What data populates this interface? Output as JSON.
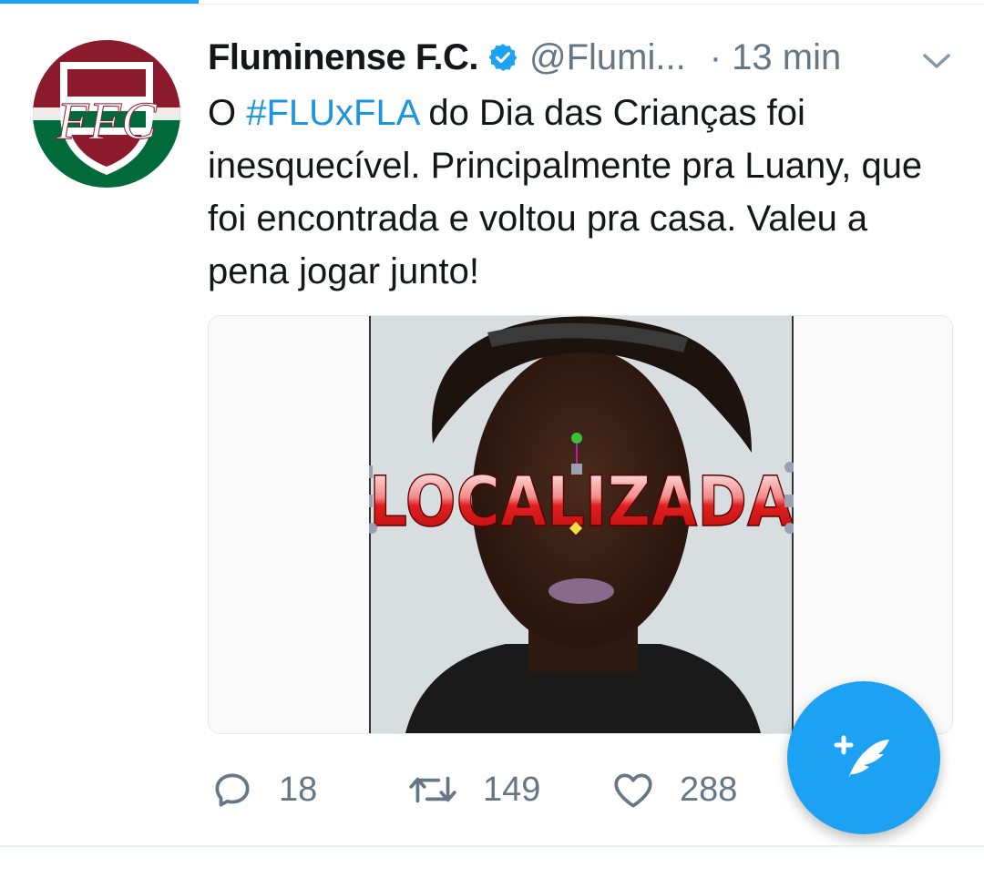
{
  "tweet": {
    "display_name": "Fluminense F.C.",
    "handle": "@Flumi...",
    "separator": "·",
    "time": "13 min",
    "text_prefix": "O ",
    "hashtag": "#FLUxFLA",
    "text_suffix": " do Dia das Crianças foi inesquecível. Principalmente pra Luany, que foi encontrada e voltou pra casa. Valeu a pena jogar junto!",
    "image_overlay_text": "LOCALIZADA",
    "avatar_monogram": "FFC",
    "club_colors": {
      "maroon": "#8b1a2c",
      "green": "#006a3a",
      "white": "#ffffff"
    }
  },
  "actions": {
    "replies": "18",
    "retweets": "149",
    "likes": "288"
  },
  "icons": {
    "verified": "verified-badge-icon",
    "chevron": "chevron-down-icon",
    "reply": "reply-icon",
    "retweet": "retweet-icon",
    "like": "heart-icon",
    "compose": "compose-tweet-icon"
  },
  "colors": {
    "accent": "#1da1f2",
    "link": "#1b95e0",
    "text": "#14171a",
    "secondary": "#657786"
  }
}
